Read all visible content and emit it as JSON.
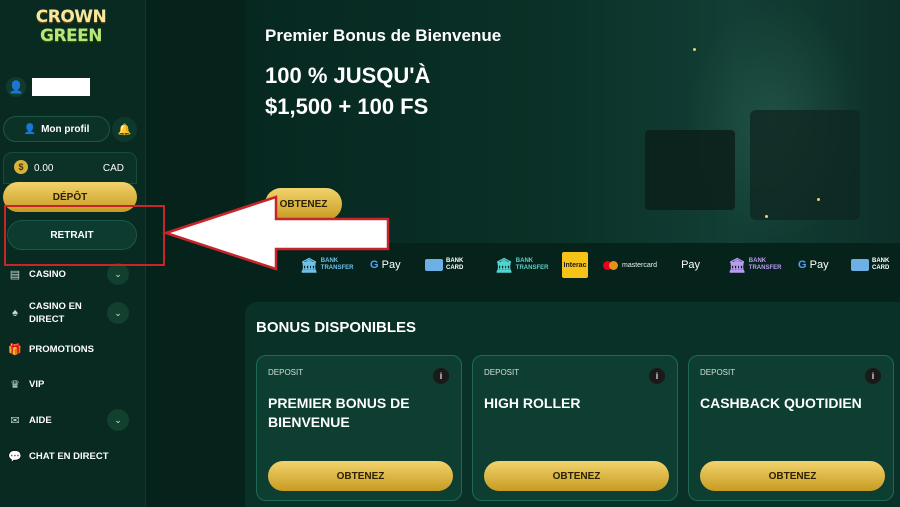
{
  "brand": {
    "line1": "CROWN",
    "line2": "GREEN"
  },
  "user": {
    "profile_label": "Mon profil"
  },
  "wallet": {
    "balance": "0.00",
    "currency": "CAD",
    "coin_symbol": "$",
    "deposit_label": "DÉPÔT",
    "withdraw_label": "RETRAIT"
  },
  "nav": [
    {
      "label": "CASINO",
      "icon": "casino-icon",
      "has_chevron": true
    },
    {
      "label": "CASINO EN DIRECT",
      "icon": "spade-icon",
      "has_chevron": true
    },
    {
      "label": "PROMOTIONS",
      "icon": "gift-icon",
      "has_chevron": false
    },
    {
      "label": "VIP",
      "icon": "crown-icon",
      "has_chevron": false
    },
    {
      "label": "AIDE",
      "icon": "mail-icon",
      "has_chevron": true
    },
    {
      "label": "CHAT EN DIRECT",
      "icon": "chat-icon",
      "has_chevron": false
    }
  ],
  "hero": {
    "subtitle": "Premier Bonus de Bienvenue",
    "title_line1": "100 % JUSQU'À",
    "title_line2": "$1,500 + 100 FS",
    "cta_label": "OBTENEZ"
  },
  "payments": [
    {
      "type": "bank",
      "line1": "BANK",
      "line2": "TRANSFER",
      "color": "#6fc1e8"
    },
    {
      "type": "gpay",
      "label": "Pay"
    },
    {
      "type": "card",
      "line1": "BANK",
      "line2": "CARD"
    },
    {
      "type": "bank",
      "line1": "BANK",
      "line2": "TRANSFER",
      "color": "#55d3d0"
    },
    {
      "type": "interac",
      "label": "Interac"
    },
    {
      "type": "mastercard",
      "label": "mastercard"
    },
    {
      "type": "applepay",
      "label": "Pay"
    },
    {
      "type": "bank",
      "line1": "BANK",
      "line2": "TRANSFER",
      "color": "#b99cf0"
    },
    {
      "type": "gpay",
      "label": "Pay"
    },
    {
      "type": "card",
      "line1": "BANK",
      "line2": "CARD"
    }
  ],
  "bonuses": {
    "heading": "BONUS DISPONIBLES",
    "cards": [
      {
        "tag": "DEPOSIT",
        "title": "PREMIER BONUS DE BIENVENUE",
        "cta": "OBTENEZ"
      },
      {
        "tag": "DEPOSIT",
        "title": "HIGH ROLLER",
        "cta": "OBTENEZ"
      },
      {
        "tag": "DEPOSIT",
        "title": "CASHBACK QUOTIDIEN",
        "cta": "OBTENEZ"
      }
    ]
  },
  "colors": {
    "accent_gold": "#e0b640",
    "background": "#06231b",
    "annotation_red": "#c8252b"
  }
}
